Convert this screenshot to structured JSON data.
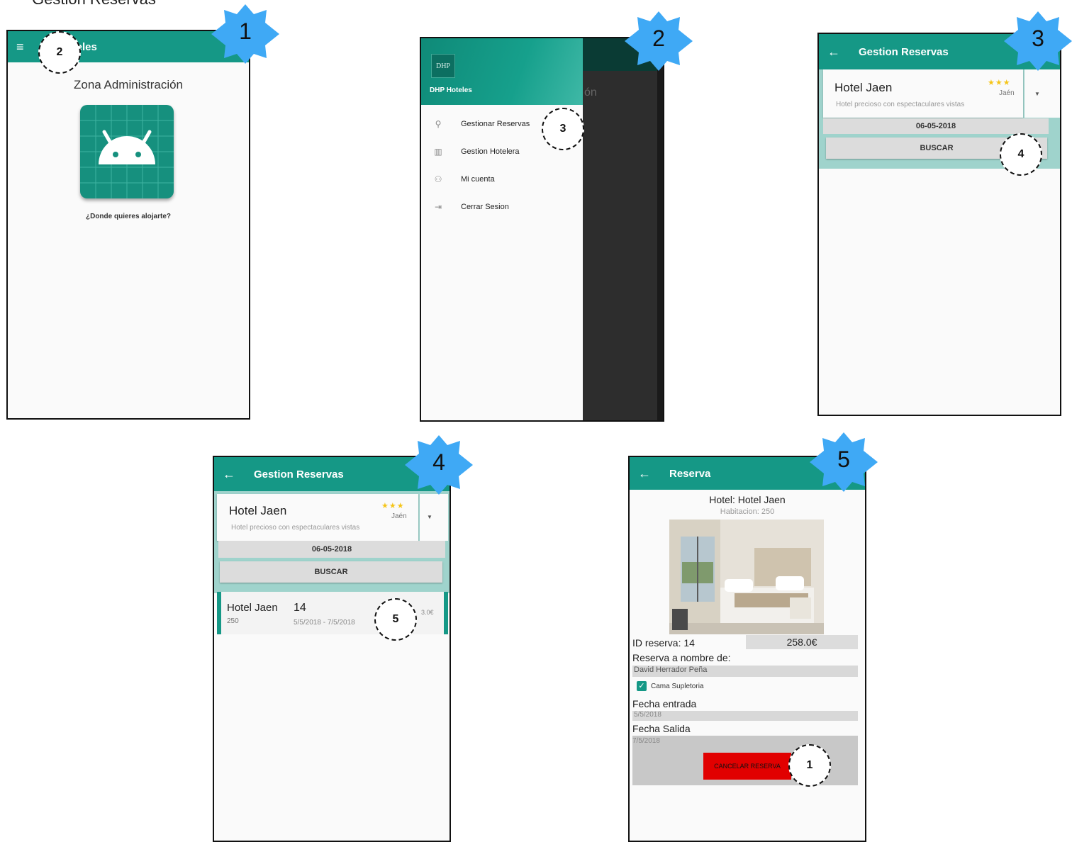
{
  "heading": "Gestion Reservas",
  "badges": [
    "1",
    "2",
    "3",
    "4",
    "5"
  ],
  "screen1": {
    "toolbar_title": "oteles",
    "menu_icon": "hamburger-icon",
    "zone_title": "Zona Administración",
    "question": "¿Donde quieres alojarte?",
    "callout": "2"
  },
  "screen2": {
    "logo_text": "DHP",
    "app_name": "DHP Hoteles",
    "behind_text": "ón",
    "menu": [
      {
        "label": "Gestionar Reservas",
        "icon": "hotel-desk-icon"
      },
      {
        "label": "Gestion Hotelera",
        "icon": "building-icon"
      },
      {
        "label": "Mi cuenta",
        "icon": "person-icon"
      },
      {
        "label": "Cerrar Sesion",
        "icon": "logout-icon"
      }
    ],
    "callout": "3"
  },
  "screen3": {
    "toolbar_title": "Gestion Reservas",
    "hotel_name": "Hotel Jaen",
    "hotel_desc": "Hotel precioso con espectaculares vistas",
    "stars": "★★★",
    "city": "Jaén",
    "date": "06-05-2018",
    "search_label": "BUSCAR",
    "callout": "4"
  },
  "screen4": {
    "toolbar_title": "Gestion Reservas",
    "hotel_name": "Hotel Jaen",
    "hotel_desc": "Hotel precioso con espectaculares vistas",
    "stars": "★★★",
    "city": "Jaén",
    "date": "06-05-2018",
    "search_label": "BUSCAR",
    "result": {
      "hotel": "Hotel Jaen",
      "room": "250",
      "id": "14",
      "dates": "5/5/2018 - 7/5/2018",
      "price_fragment": "3.0€"
    },
    "callout": "5"
  },
  "screen5": {
    "toolbar_title": "Reserva",
    "hotel_line": "Hotel: Hotel Jaen",
    "room_line": "Habitacion: 250",
    "id_label": "ID reserva: 14",
    "price": "258.0€",
    "name_label": "Reserva a nombre de:",
    "name_value": "David Herrador Peña",
    "extra_bed": "Cama Supletoria",
    "extra_bed_checked": true,
    "checkin_label": "Fecha entrada",
    "checkin_value": "5/5/2018",
    "checkout_label": "Fecha Salida",
    "checkout_value": "7/5/2018",
    "cancel_label": "CANCELAR RESERVA",
    "callout": "1"
  },
  "colors": {
    "teal": "#159886",
    "teal_light": "#9fd3cc",
    "badge_blue": "#3fa9f5",
    "cancel_red": "#e10000"
  }
}
